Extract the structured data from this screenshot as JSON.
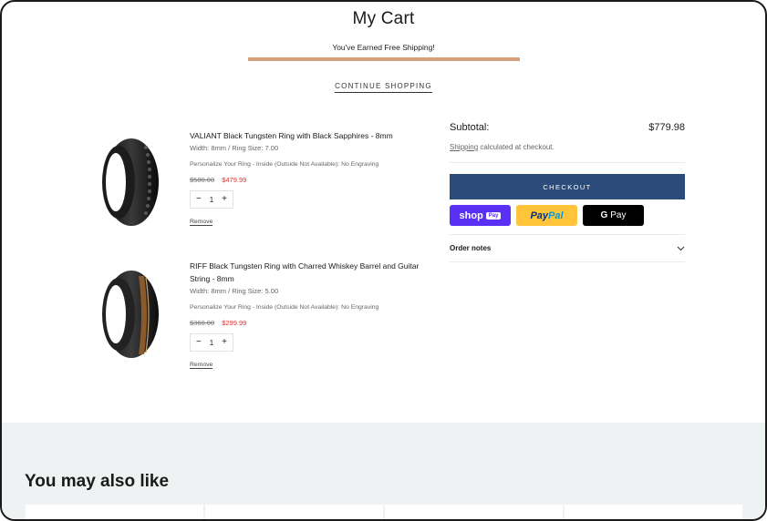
{
  "header": {
    "title": "My Cart",
    "free_shipping_message": "You've Earned Free Shipping!",
    "free_shipping_progress": 1.0,
    "continue_shopping": "CONTINUE SHOPPING"
  },
  "cart": {
    "items": [
      {
        "name": "VALIANT Black Tungsten Ring with Black Sapphires - 8mm",
        "variant": "Width: 8mm / Ring Size: 7.00",
        "personalize": "Personalize Your Ring - Inside (Outside Not Available): No Engraving",
        "price_old": "$580.00",
        "price_new": "$479.99",
        "quantity": "1",
        "remove_label": "Remove"
      },
      {
        "name": "RIFF Black Tungsten Ring with Charred Whiskey Barrel and Guitar String - 8mm",
        "variant": "Width: 8mm / Ring Size: 5.00",
        "personalize": "Personalize Your Ring - Inside (Outside Not Available): No Engraving",
        "price_old": "$360.00",
        "price_new": "$299.99",
        "quantity": "1",
        "remove_label": "Remove"
      }
    ],
    "qty_minus": "−",
    "qty_plus": "+"
  },
  "summary": {
    "subtotal_label": "Subtotal:",
    "subtotal_value": "$779.98",
    "shipping_link": "Shipping",
    "shipping_note": " calculated at checkout.",
    "checkout_label": "CHECKOUT",
    "shop_pay": {
      "text": "shop",
      "badge": "Pay"
    },
    "paypal": {
      "p1": "Pay",
      "p2": "Pal"
    },
    "gpay": {
      "g": "G",
      "text": "Pay"
    },
    "order_notes_label": "Order notes"
  },
  "related": {
    "title": "You may also like"
  },
  "colors": {
    "checkout_bg": "#2b4b7a",
    "sale_price": "#dd3333",
    "shipping_bar": "#d8a07a",
    "related_bg": "#eff2f2"
  }
}
